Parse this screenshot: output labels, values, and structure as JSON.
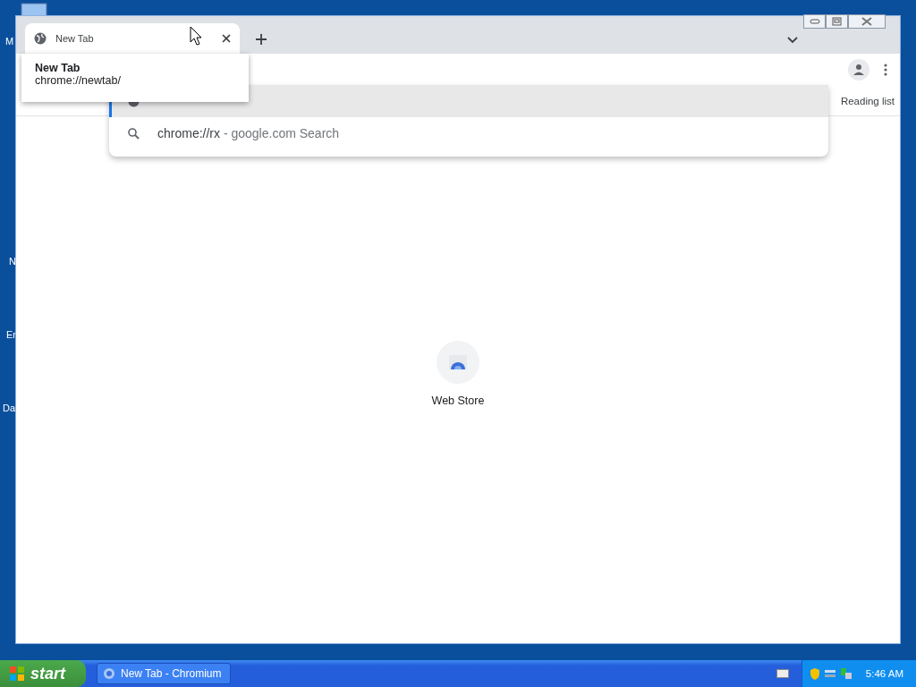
{
  "desktop": {
    "icon_labels": [
      "M",
      "N",
      "Er",
      "Da"
    ]
  },
  "window": {
    "tabs": [
      {
        "title": "New Tab",
        "selected": true
      }
    ],
    "tooltip": {
      "title": "New Tab",
      "url": "chrome://newtab/"
    },
    "omnibox": {
      "suggestions": [
        {
          "kind": "url",
          "selected": true
        },
        {
          "kind": "search",
          "text": "chrome://rx",
          "hint": " - google.com Search",
          "selected": false
        }
      ]
    },
    "bookmarks_bar": {
      "items": [
        "Reading list"
      ]
    },
    "shortcuts": [
      {
        "title": "Web Store"
      }
    ]
  },
  "taskbar": {
    "start": "start",
    "tasks": [
      {
        "title": "New Tab - Chromium",
        "selected": false
      }
    ],
    "clock": "5:46 AM"
  }
}
